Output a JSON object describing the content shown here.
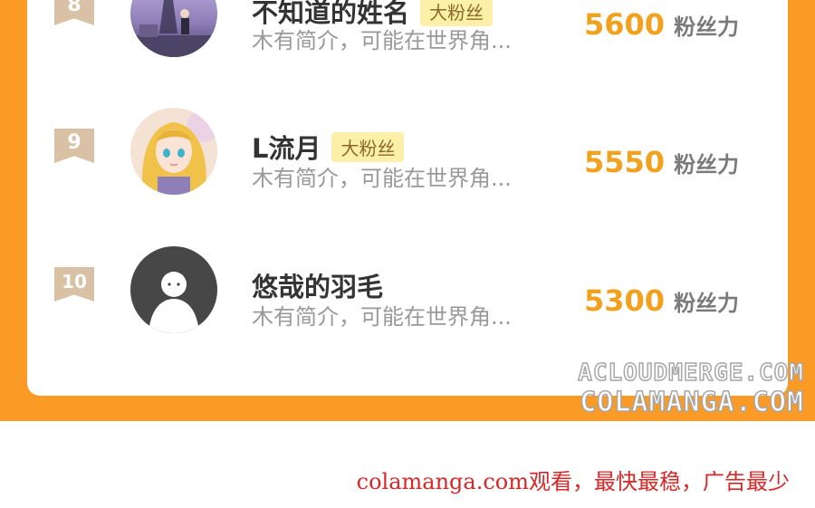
{
  "ranking": [
    {
      "rank": "8",
      "name": "不知道的姓名",
      "badge": "大粉丝",
      "bio": "木有简介，可能在世界角...",
      "score": "5600",
      "unit": "粉丝力",
      "avatar": "paris-eiffel-photo-avatar"
    },
    {
      "rank": "9",
      "name": "L流月",
      "badge": "大粉丝",
      "bio": "木有简介，可能在世界角...",
      "score": "5550",
      "unit": "粉丝力",
      "avatar": "anime-princess-avatar"
    },
    {
      "rank": "10",
      "name": "悠哉的羽毛",
      "badge": "",
      "bio": "木有简介，可能在世界角...",
      "score": "5300",
      "unit": "粉丝力",
      "avatar": "default-user-avatar"
    }
  ],
  "watermark": {
    "line1": "ACLOUDMERGE.COM",
    "line2": "COLAMANGA.COM"
  },
  "footer": {
    "text": "colamanga.com观看，最快最稳，广告最少"
  },
  "colors": {
    "accent_orange": "#fb9b26",
    "score_gold": "#f2a11f",
    "badge_bg": "#fcefa8",
    "footer_red": "#d62828"
  }
}
